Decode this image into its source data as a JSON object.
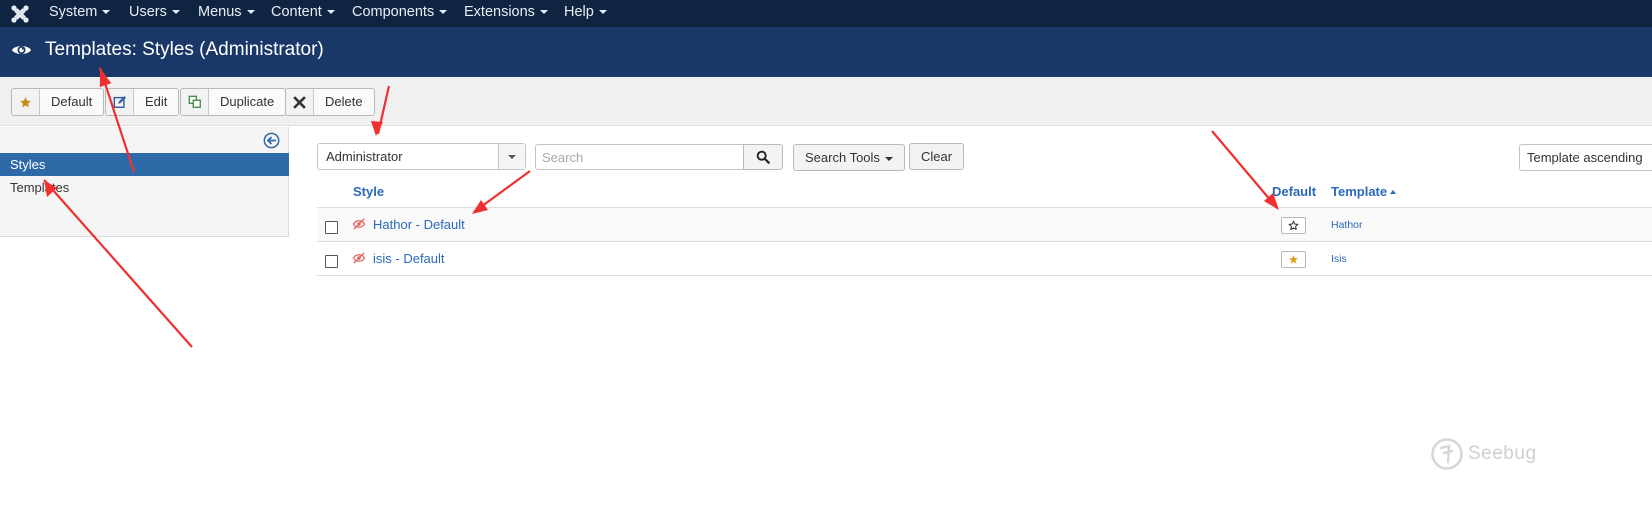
{
  "nav": {
    "items": [
      {
        "label": "System"
      },
      {
        "label": "Users"
      },
      {
        "label": "Menus"
      },
      {
        "label": "Content"
      },
      {
        "label": "Components"
      },
      {
        "label": "Extensions"
      },
      {
        "label": "Help"
      }
    ]
  },
  "header": {
    "title": "Templates: Styles (Administrator)"
  },
  "toolbar": {
    "default_label": "Default",
    "edit_label": "Edit",
    "duplicate_label": "Duplicate",
    "delete_label": "Delete"
  },
  "sidebar": {
    "items": [
      {
        "label": "Styles",
        "active": true
      },
      {
        "label": "Templates",
        "active": false
      }
    ]
  },
  "filters": {
    "client_value": "Administrator",
    "search_placeholder": "Search",
    "search_tools_label": "Search Tools",
    "clear_label": "Clear",
    "sort_value": "Template ascending"
  },
  "table": {
    "headers": {
      "style": "Style",
      "default": "Default",
      "template": "Template"
    },
    "rows": [
      {
        "style": "Hathor - Default",
        "default": false,
        "template": "Hathor"
      },
      {
        "style": "isis - Default",
        "default": true,
        "template": "Isis"
      }
    ]
  },
  "watermark": {
    "text": "Seebug"
  },
  "colors": {
    "nav_bg": "#0f2441",
    "header_bg": "#1a3867",
    "link": "#2a69b8",
    "sidebar_active": "#2f6aa8",
    "star_default": "#e0a21e",
    "arrow": "#f03030"
  }
}
